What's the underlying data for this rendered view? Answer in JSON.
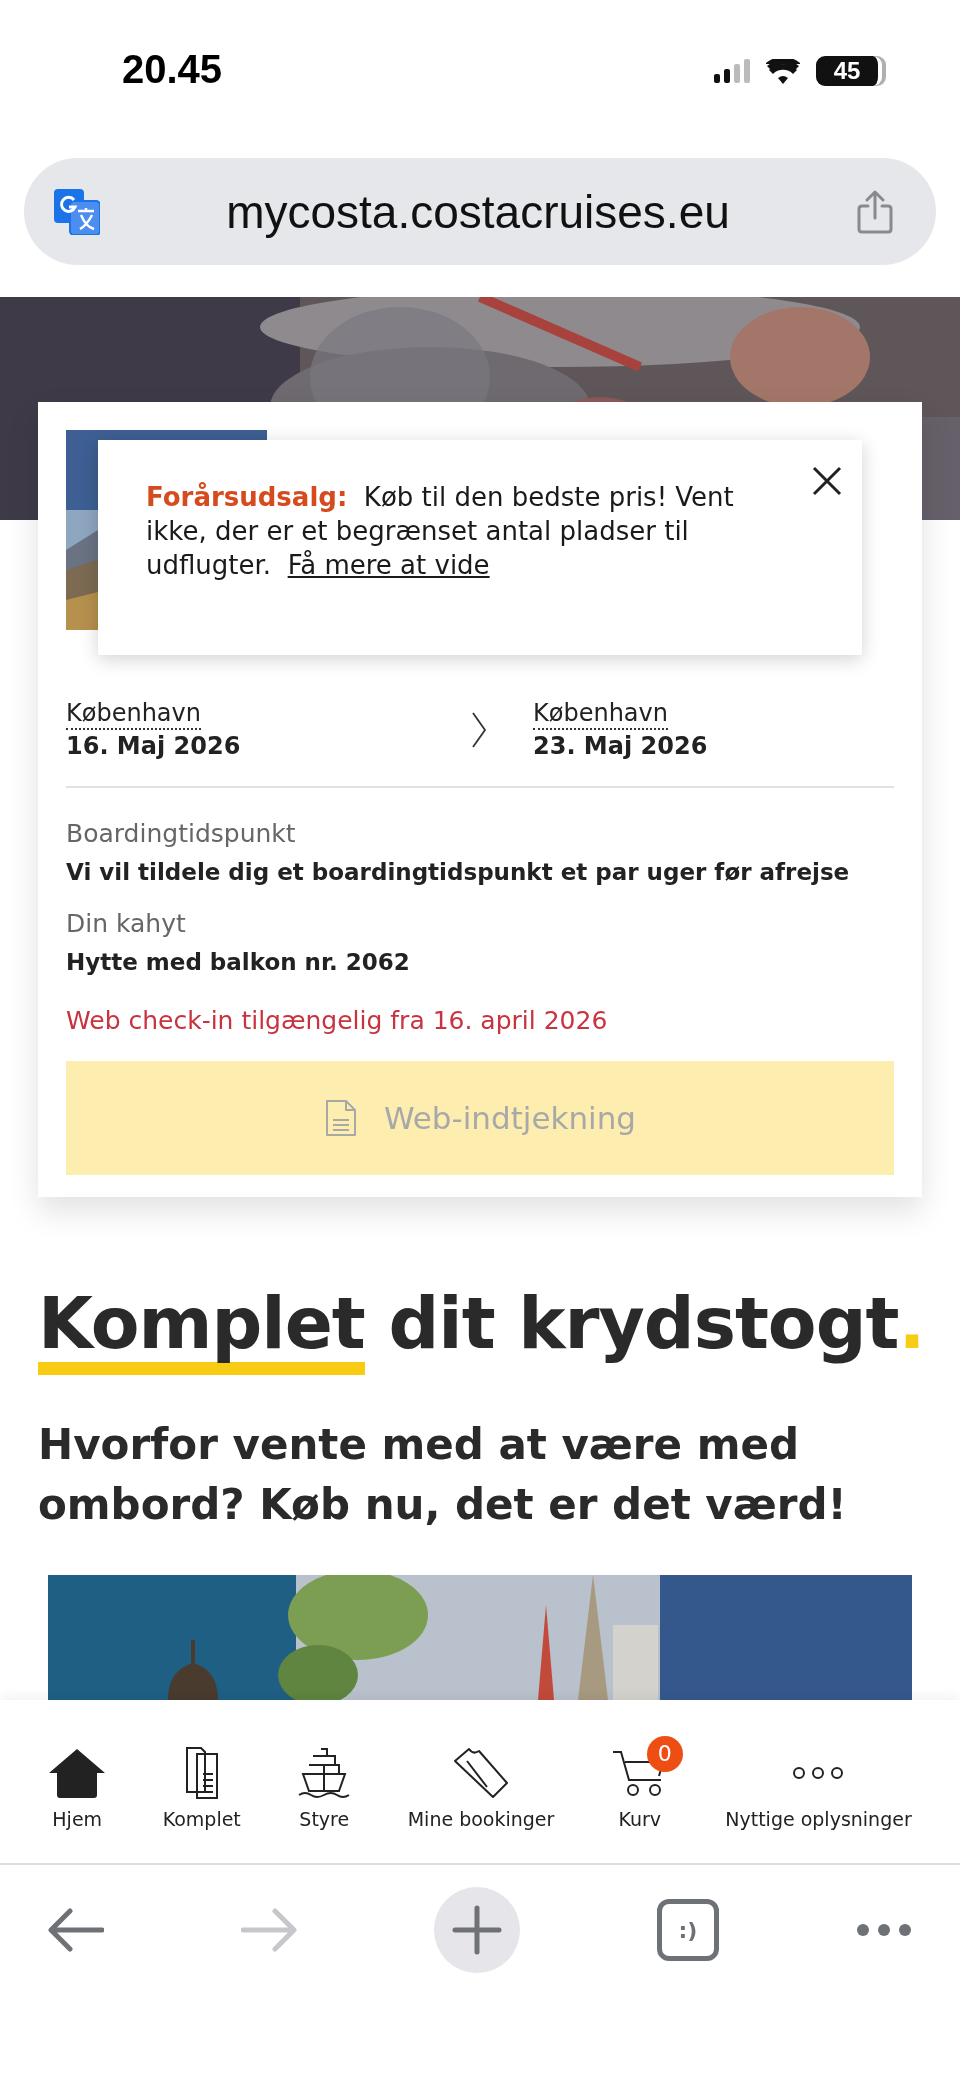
{
  "status_bar": {
    "time": "20.45",
    "battery": "45"
  },
  "address_bar": {
    "url": "mycosta.costacruises.eu"
  },
  "booking_card": {
    "promo": {
      "label": "Forårsudsalg:",
      "message": "Køb til den bedste pris! Vent ikke, der er et begrænset antal pladser til udflugter.",
      "link": "Få mere at vide"
    },
    "departure": {
      "port": "København",
      "date": "16. Maj 2026"
    },
    "arrival": {
      "port": "København",
      "date": "23. Maj 2026"
    },
    "details": [
      {
        "label": "Boardingtidspunkt",
        "value": "Vi vil tildele dig et boardingtidspunkt et par uger før afrejse"
      },
      {
        "label": "Din kahyt",
        "value": "Hytte med balkon nr. 2062"
      }
    ],
    "notice": "Web check-in tilgængelig fra 16. april 2026",
    "checkin_button": {
      "label": "Web-indtjekning",
      "disabled": true
    }
  },
  "section": {
    "heading_underlined": "Komplet",
    "heading_rest": "dit krydstogt",
    "heading_dot": ".",
    "subheading": "Hvorfor vente med at være med ombord? Køb nu, det er det værd!"
  },
  "bottom_nav": [
    {
      "kind": "home",
      "label": "Hjem"
    },
    {
      "kind": "brochure",
      "label": "Komplet"
    },
    {
      "kind": "ship",
      "label": "Styre"
    },
    {
      "kind": "ticket",
      "label": "Mine bookinger"
    },
    {
      "kind": "cart",
      "label": "Kurv",
      "badge": "0"
    },
    {
      "kind": "more",
      "label": "Nyttige oplysninger"
    }
  ],
  "browser_toolbar": {
    "back_disabled": false,
    "forward_disabled": true,
    "tabs_label": ":)"
  }
}
